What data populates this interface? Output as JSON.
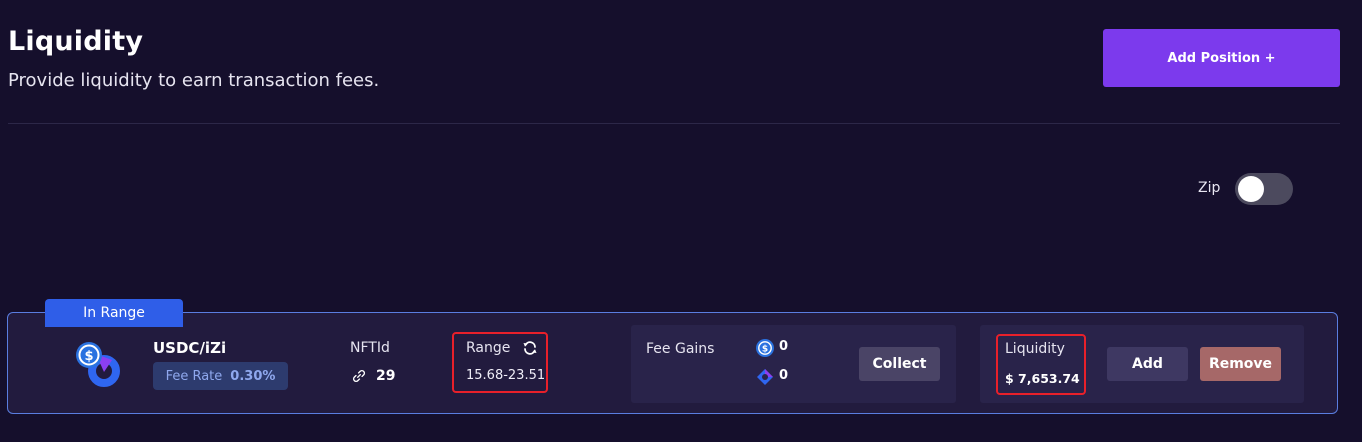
{
  "header": {
    "title": "Liquidity",
    "subtitle": "Provide liquidity to earn transaction fees.",
    "add_position_label": "Add Position +"
  },
  "zip_toggle": {
    "label": "Zip",
    "on": false
  },
  "position": {
    "status": "In Range",
    "pair": "USDC/iZi",
    "pair_icons": [
      "usdc-icon",
      "izi-icon"
    ],
    "fee_rate_label": "Fee Rate",
    "fee_rate_value": "0.30%",
    "nft_label": "NFTId",
    "nft_value": "29",
    "range_label": "Range",
    "range_value": "15.68-23.51",
    "fee_gains_label": "Fee Gains",
    "fee_gains": [
      {
        "token_icon": "usdc-icon",
        "value": "0"
      },
      {
        "token_icon": "izi-icon",
        "value": "0"
      }
    ],
    "collect_label": "Collect",
    "liquidity_label": "Liquidity",
    "liquidity_value": "$ 7,653.74",
    "add_label": "Add",
    "remove_label": "Remove"
  },
  "colors": {
    "background": "#150f2c",
    "accent": "#7c3aed",
    "status_tab": "#2f5ee8",
    "highlight_border": "#e8202a",
    "remove_button": "#a66868"
  }
}
